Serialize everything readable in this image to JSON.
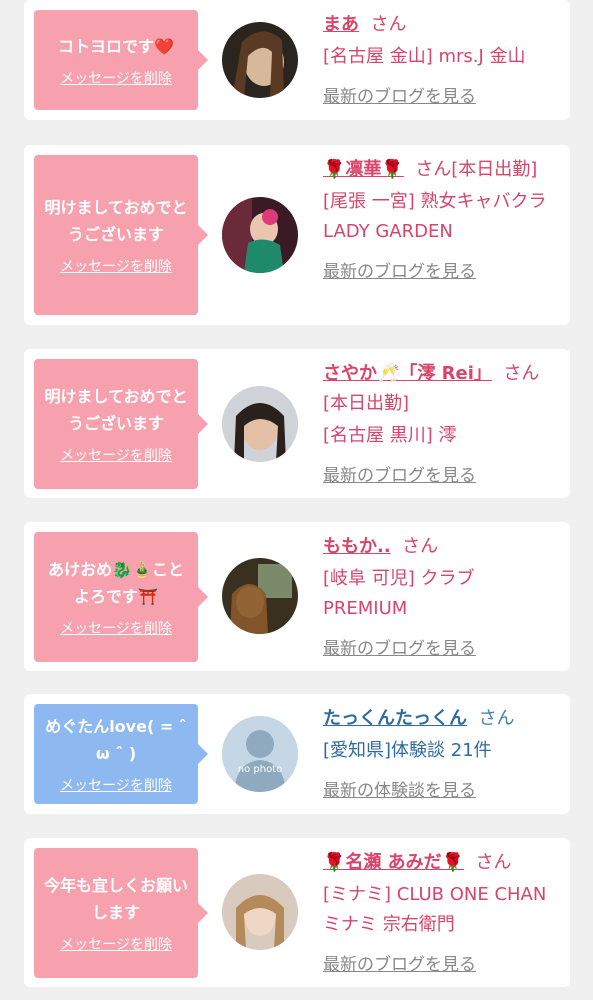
{
  "cards": [
    {
      "message": "コトヨロです❤️",
      "delete": "メッセージを削除",
      "name": "まあ",
      "san": "さん",
      "shop": "[名古屋 金山] mrs.J 金山",
      "link": "最新のブログを見る"
    },
    {
      "message": "明けましておめでとうございます",
      "delete": "メッセージを削除",
      "name": "🌹凛華🌹",
      "san": "さん[本日出勤]",
      "shop": "[尾張 一宮] 熟女キャバクラ LADY GARDEN",
      "link": "最新のブログを見る"
    },
    {
      "message": "明けましておめでとうございます",
      "delete": "メッセージを削除",
      "name": "さやか🥂「澪 Rei」",
      "san": "さん[本日出勤]",
      "shop": "[名古屋 黒川] 澪",
      "link": "最新のブログを見る"
    },
    {
      "message": "あけおめ🐉🎍ことよろです⛩️",
      "delete": "メッセージを削除",
      "name": "ももか..",
      "san": "さん",
      "shop": "[岐阜 可児] クラブ PREMIUM",
      "link": "最新のブログを見る"
    },
    {
      "message": "めぐたんlove( = ˆ ω ˆ )",
      "delete": "メッセージを削除",
      "name": "たっくんたっくん",
      "san": "さん",
      "shop": "[愛知県]体験談 21件",
      "link": "最新の体験談を見る",
      "avatar_text": "no photo"
    },
    {
      "message": "今年も宜しくお願いします",
      "delete": "メッセージを削除",
      "name": "🌹名瀬 あみだ🌹",
      "san": "さん",
      "shop": "[ミナミ] CLUB ONE CHAN ミナミ 宗右衛門",
      "link": "最新のブログを見る"
    }
  ],
  "colors": {
    "pink": "#f8a1ae",
    "blue": "#8db8f0",
    "name_pink": "#d9456a",
    "name_blue": "#2f6aa3"
  }
}
